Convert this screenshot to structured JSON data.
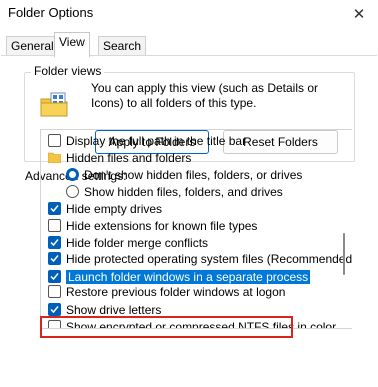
{
  "window": {
    "title": "Folder Options",
    "close_glyph": "✕"
  },
  "tabs": [
    {
      "label": "General",
      "active": false
    },
    {
      "label": "View",
      "active": true
    },
    {
      "label": "Search",
      "active": false
    }
  ],
  "folder_views": {
    "group_label": "Folder views",
    "description": "You can apply this view (such as Details or Icons) to all folders of this type.",
    "apply_button": "Apply to Folders",
    "reset_button": "Reset Folders"
  },
  "advanced": {
    "label": "Advanced settings:",
    "items": [
      {
        "kind": "checkbox",
        "checked": false,
        "label": "Display the full path in the title bar"
      },
      {
        "kind": "folder",
        "label": "Hidden files and folders"
      },
      {
        "kind": "radio",
        "checked": true,
        "label": "Don't show hidden files, folders, or drives"
      },
      {
        "kind": "radio",
        "checked": false,
        "label": "Show hidden files, folders, and drives"
      },
      {
        "kind": "checkbox",
        "checked": true,
        "label": "Hide empty drives"
      },
      {
        "kind": "checkbox",
        "checked": false,
        "label": "Hide extensions for known file types"
      },
      {
        "kind": "checkbox",
        "checked": true,
        "label": "Hide folder merge conflicts"
      },
      {
        "kind": "checkbox",
        "checked": true,
        "label": "Hide protected operating system files (Recommended)"
      },
      {
        "kind": "checkbox",
        "checked": true,
        "label": "Launch folder windows in a separate process",
        "selected": true
      },
      {
        "kind": "checkbox",
        "checked": false,
        "label": "Restore previous folder windows at logon"
      },
      {
        "kind": "checkbox",
        "checked": true,
        "label": "Show drive letters"
      },
      {
        "kind": "checkbox",
        "checked": false,
        "label": "Show encrypted or compressed NTFS files in color"
      }
    ]
  },
  "colors": {
    "accent": "#005fb8",
    "selection": "#0078d7",
    "annotation": "#d9261c"
  }
}
